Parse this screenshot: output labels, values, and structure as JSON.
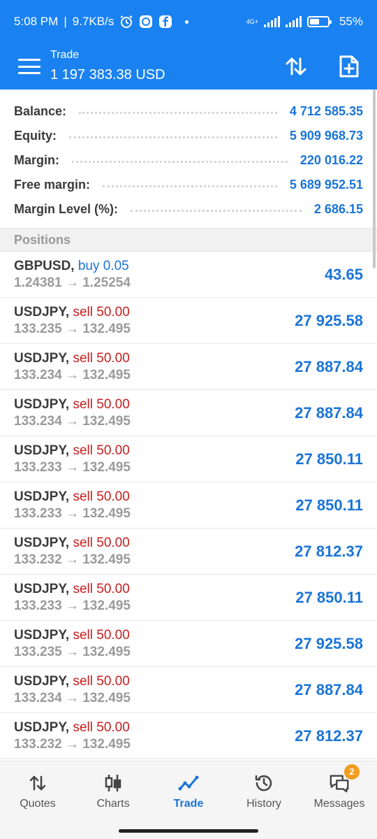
{
  "status_bar": {
    "time": "5:08 PM",
    "separator": "|",
    "speed": "9.7KB/s",
    "network": "4G+",
    "battery": "55%"
  },
  "header": {
    "subtitle": "Trade",
    "balance_title": "1 197 383.38 USD"
  },
  "summary": [
    {
      "label": "Balance:",
      "value": "4 712 585.35"
    },
    {
      "label": "Equity:",
      "value": "5 909 968.73"
    },
    {
      "label": "Margin:",
      "value": "220 016.22"
    },
    {
      "label": "Free margin:",
      "value": "5 689 952.51"
    },
    {
      "label": "Margin Level (%):",
      "value": "2 686.15"
    }
  ],
  "section_title": "Positions",
  "positions": [
    {
      "symbol": "GBPUSD,",
      "side": "buy 0.05",
      "side_type": "buy",
      "prices": "1.24381 → 1.25254",
      "profit": "43.65"
    },
    {
      "symbol": "USDJPY,",
      "side": "sell 50.00",
      "side_type": "sell",
      "prices": "133.235 → 132.495",
      "profit": "27 925.58"
    },
    {
      "symbol": "USDJPY,",
      "side": "sell 50.00",
      "side_type": "sell",
      "prices": "133.234 → 132.495",
      "profit": "27 887.84"
    },
    {
      "symbol": "USDJPY,",
      "side": "sell 50.00",
      "side_type": "sell",
      "prices": "133.234 → 132.495",
      "profit": "27 887.84"
    },
    {
      "symbol": "USDJPY,",
      "side": "sell 50.00",
      "side_type": "sell",
      "prices": "133.233 → 132.495",
      "profit": "27 850.11"
    },
    {
      "symbol": "USDJPY,",
      "side": "sell 50.00",
      "side_type": "sell",
      "prices": "133.233 → 132.495",
      "profit": "27 850.11"
    },
    {
      "symbol": "USDJPY,",
      "side": "sell 50.00",
      "side_type": "sell",
      "prices": "133.232 → 132.495",
      "profit": "27 812.37"
    },
    {
      "symbol": "USDJPY,",
      "side": "sell 50.00",
      "side_type": "sell",
      "prices": "133.233 → 132.495",
      "profit": "27 850.11"
    },
    {
      "symbol": "USDJPY,",
      "side": "sell 50.00",
      "side_type": "sell",
      "prices": "133.235 → 132.495",
      "profit": "27 925.58"
    },
    {
      "symbol": "USDJPY,",
      "side": "sell 50.00",
      "side_type": "sell",
      "prices": "133.234 → 132.495",
      "profit": "27 887.84"
    },
    {
      "symbol": "USDJPY,",
      "side": "sell 50.00",
      "side_type": "sell",
      "prices": "133.232 → 132.495",
      "profit": "27 812.37"
    }
  ],
  "bottom_nav": [
    {
      "label": "Quotes",
      "icon": "quotes-icon"
    },
    {
      "label": "Charts",
      "icon": "charts-icon"
    },
    {
      "label": "Trade",
      "icon": "trade-icon",
      "active": true
    },
    {
      "label": "History",
      "icon": "history-icon"
    },
    {
      "label": "Messages",
      "icon": "messages-icon",
      "badge": "2"
    }
  ],
  "colors": {
    "header_blue": "#1a82f0",
    "value_blue": "#1a74d8",
    "sell_red": "#c81e1e",
    "badge_orange": "#f39c1f"
  }
}
